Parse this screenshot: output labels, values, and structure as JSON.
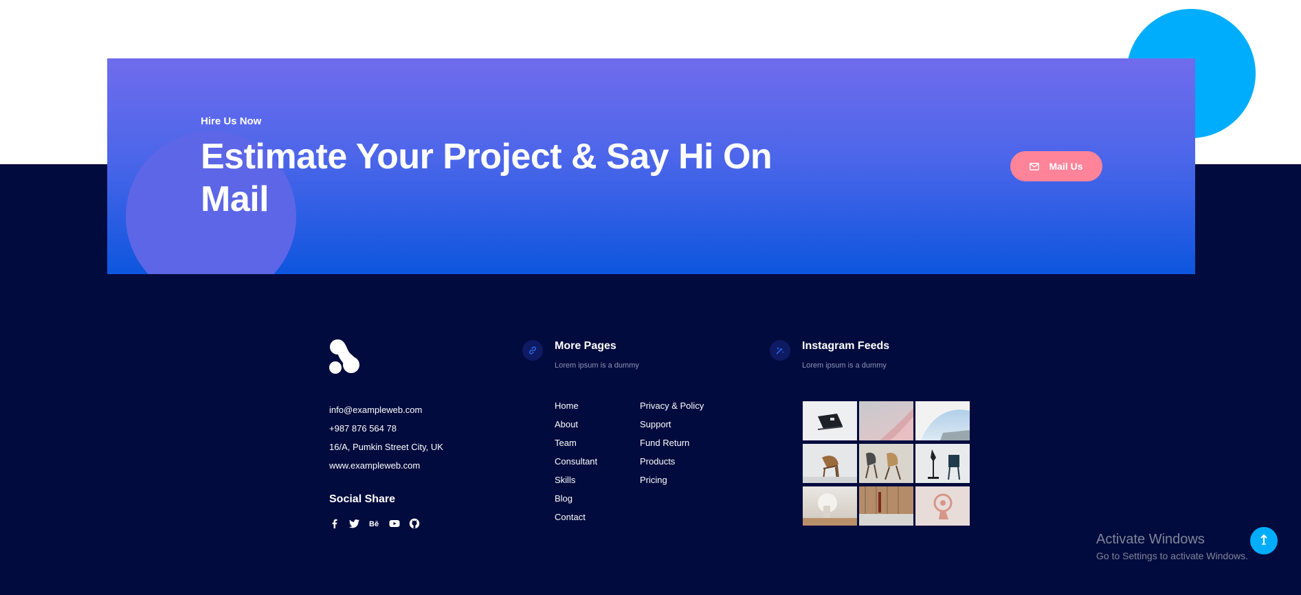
{
  "cta": {
    "subtitle": "Hire Us Now",
    "title": "Estimate Your Project & Say Hi On Mail",
    "button_label": "Mail Us"
  },
  "contact": {
    "email": "info@exampleweb.com",
    "phone": "+987 876 564 78",
    "address": "16/A, Pumkin Street City, UK",
    "website": "www.exampleweb.com"
  },
  "social": {
    "title": "Social Share",
    "icons": [
      "facebook-icon",
      "twitter-icon",
      "behance-icon",
      "youtube-icon",
      "github-icon"
    ]
  },
  "more_pages": {
    "title": "More Pages",
    "subtitle": "Lorem ipsum is a dummy",
    "links_left": [
      "Home",
      "About",
      "Team",
      "Consultant",
      "Skills",
      "Blog",
      "Contact"
    ],
    "links_right": [
      "Privacy & Policy",
      "Support",
      "Fund Return",
      "Products",
      "Pricing"
    ]
  },
  "instagram": {
    "title": "Instagram Feeds",
    "subtitle": "Lorem ipsum is a dummy"
  },
  "windows": {
    "title": "Activate Windows",
    "subtitle": "Go to Settings to activate Windows."
  },
  "colors": {
    "footer_bg": "#020b3d",
    "accent_blue": "#00adfc",
    "button_pink": "#ff8399",
    "gradient_top": "#6f6cec",
    "gradient_bottom": "#0d56de"
  }
}
